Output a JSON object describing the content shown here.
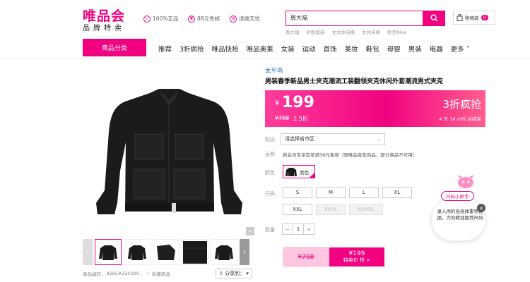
{
  "header": {
    "logo": "唯品会",
    "logo_sub": "品牌特卖",
    "promos": [
      {
        "icon": "shield-check-icon",
        "label": "100%正品"
      },
      {
        "icon": "coin-icon",
        "label": "88元免邮"
      },
      {
        "icon": "return-icon",
        "label": "退换无忧"
      }
    ],
    "search": {
      "value": "周大福",
      "hot": [
        "周大福",
        "护肤套装",
        "女式休闲裤",
        "女休闲裤",
        "耐克Nike"
      ]
    },
    "cart": {
      "label": "购物袋",
      "count": "0"
    }
  },
  "nav": {
    "category_button": "商品分类",
    "items": [
      "推荐",
      "3折疯抢",
      "唯品快抢",
      "唯品奥莱",
      "女装",
      "运动",
      "首饰",
      "美妆",
      "鞋包",
      "母婴",
      "男装",
      "电器",
      "更多"
    ]
  },
  "product": {
    "brand": "太平鸟",
    "title": "男装春季新品男士夹克潮流工装翻领夹克休闲外套潮流男式夹克",
    "price": {
      "currency": "¥",
      "value": "199",
      "original": "¥798",
      "discount": "2.5折"
    },
    "flash": {
      "label": "3折疯抢",
      "countdown": "4 天 18 小时 后结束"
    },
    "delivery": {
      "label": "配送",
      "placeholder": "请选择省市区"
    },
    "shipping": {
      "label": "运费",
      "text": "新会员专享首单满38元免邮（限唯品自营商品，部分商品不可用）"
    },
    "color": {
      "label": "颜色",
      "selected": "黑色"
    },
    "size": {
      "label": "尺码",
      "options": [
        "S",
        "M",
        "L",
        "XL",
        "XXL",
        "XXXL",
        "XXXXL"
      ],
      "disabled": [
        "XXXL",
        "XXXXL"
      ]
    },
    "quantity": {
      "label": "数量",
      "value": "1"
    },
    "buy": {
      "original": "¥798",
      "price": "¥199",
      "cta": "特卖价 抢 >"
    },
    "code_label": "商品编码：",
    "code": "82BCA320289",
    "favorite": "收藏商品",
    "share": "分享到："
  },
  "helper": {
    "tag": "尺码小帮手",
    "text": "录入你的身高体重等数据，为你精准推荐尺码"
  },
  "colors": {
    "brand": "#f10180",
    "link": "#1565c0"
  }
}
